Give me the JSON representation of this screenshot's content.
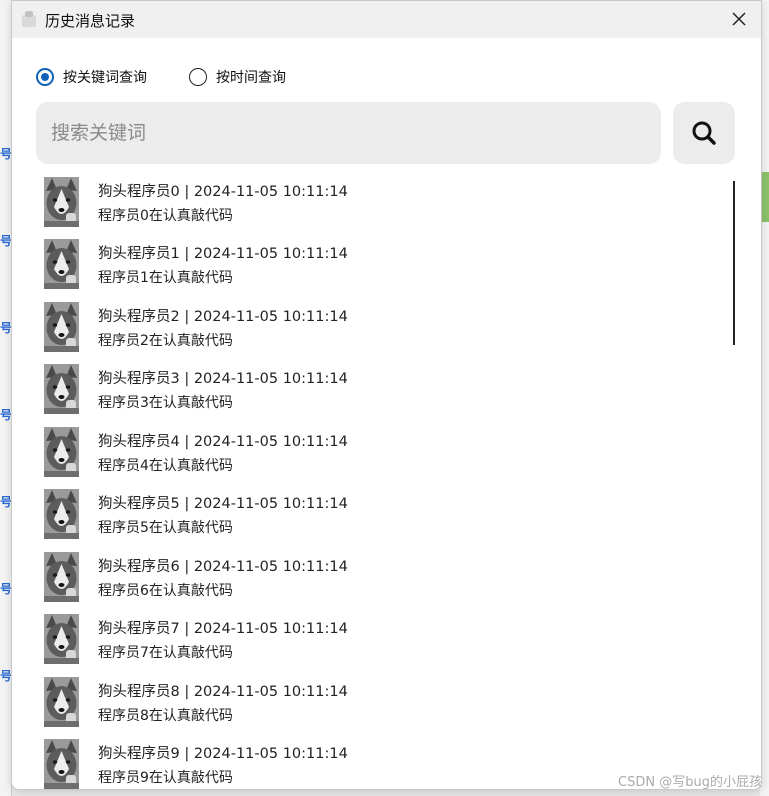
{
  "window": {
    "title": "历史消息记录"
  },
  "search_mode": {
    "options": [
      {
        "label": "按关键词查询",
        "checked": true
      },
      {
        "label": "按时间查询",
        "checked": false
      }
    ]
  },
  "search": {
    "placeholder": "搜索关键词",
    "value": ""
  },
  "messages": [
    {
      "header": "狗头程序员0 | 2024-11-05 10:11:14",
      "text": "程序员0在认真敲代码"
    },
    {
      "header": "狗头程序员1 | 2024-11-05 10:11:14",
      "text": "程序员1在认真敲代码"
    },
    {
      "header": "狗头程序员2 | 2024-11-05 10:11:14",
      "text": "程序员2在认真敲代码"
    },
    {
      "header": "狗头程序员3 | 2024-11-05 10:11:14",
      "text": "程序员3在认真敲代码"
    },
    {
      "header": "狗头程序员4 | 2024-11-05 10:11:14",
      "text": "程序员4在认真敲代码"
    },
    {
      "header": "狗头程序员5 | 2024-11-05 10:11:14",
      "text": "程序员5在认真敲代码"
    },
    {
      "header": "狗头程序员6 | 2024-11-05 10:11:14",
      "text": "程序员6在认真敲代码"
    },
    {
      "header": "狗头程序员7 | 2024-11-05 10:11:14",
      "text": "程序员7在认真敲代码"
    },
    {
      "header": "狗头程序员8 | 2024-11-05 10:11:14",
      "text": "程序员8在认真敲代码"
    },
    {
      "header": "狗头程序员9 | 2024-11-05 10:11:14",
      "text": "程序员9在认真敲代码"
    }
  ],
  "icons": {
    "close": "close-icon",
    "search": "search-icon",
    "avatar": "husky-avatar"
  },
  "colors": {
    "radio_accent": "#0f62b8",
    "input_bg": "#ececec",
    "background_app_green": "#8bc46b"
  },
  "watermark": "CSDN @写bug的小屁孩"
}
